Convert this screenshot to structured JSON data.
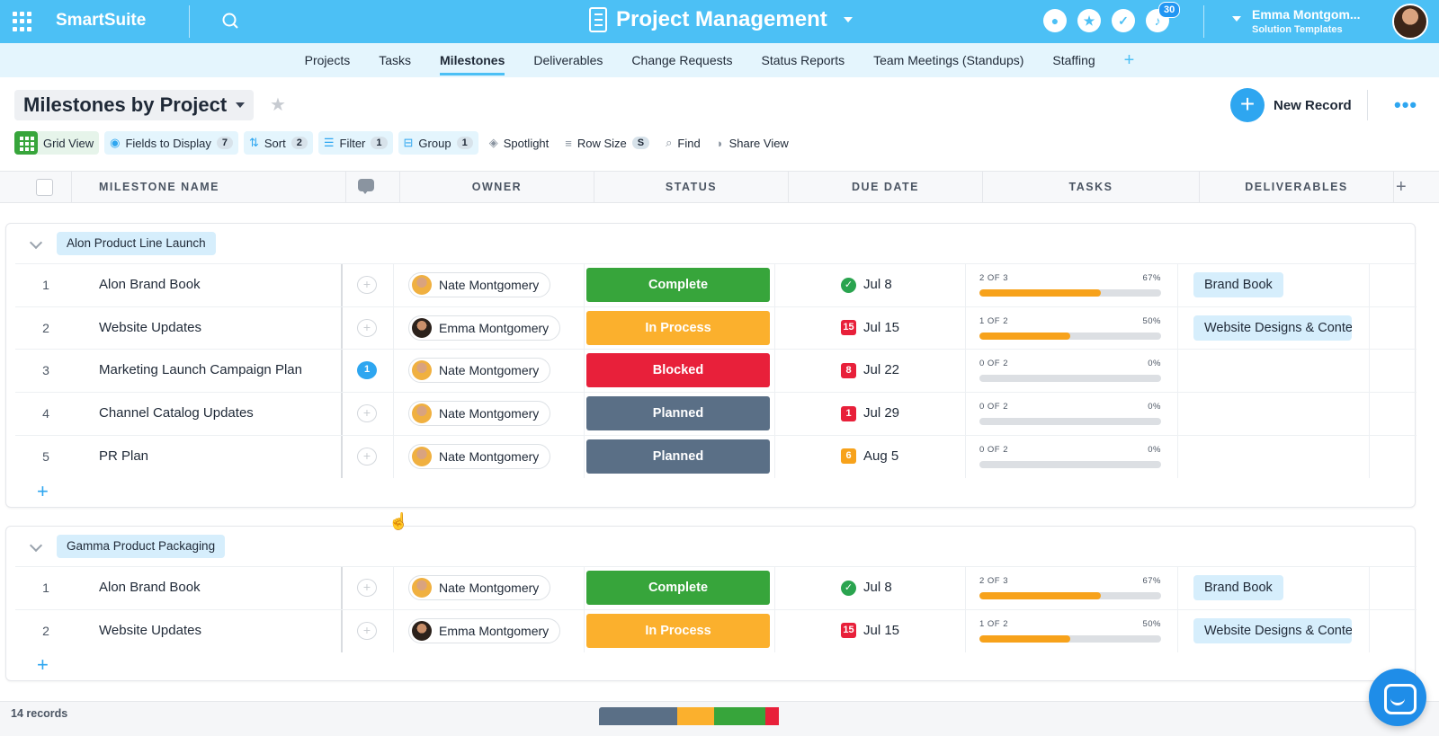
{
  "topbar": {
    "brand": "SmartSuite",
    "solution_title": "Project Management",
    "notification_count": "30",
    "user_name": "Emma Montgom...",
    "user_workspace": "Solution Templates"
  },
  "app_tabs": [
    {
      "label": "Projects",
      "active": false
    },
    {
      "label": "Tasks",
      "active": false
    },
    {
      "label": "Milestones",
      "active": true
    },
    {
      "label": "Deliverables",
      "active": false
    },
    {
      "label": "Change Requests",
      "active": false
    },
    {
      "label": "Status Reports",
      "active": false
    },
    {
      "label": "Team Meetings (Standups)",
      "active": false
    },
    {
      "label": "Staffing",
      "active": false
    }
  ],
  "view": {
    "title": "Milestones by Project",
    "new_record_label": "New Record"
  },
  "toolbar": {
    "grid_view": "Grid View",
    "fields": "Fields to Display",
    "fields_count": "7",
    "sort": "Sort",
    "sort_count": "2",
    "filter": "Filter",
    "filter_count": "1",
    "group": "Group",
    "group_count": "1",
    "spotlight": "Spotlight",
    "row_size": "Row Size",
    "row_size_value": "S",
    "find": "Find",
    "share_view": "Share View"
  },
  "columns": {
    "name": "MILESTONE NAME",
    "owner": "OWNER",
    "status": "STATUS",
    "due_date": "DUE DATE",
    "tasks": "TASKS",
    "deliverables": "DELIVERABLES"
  },
  "colors": {
    "accent": "#4cc0f5",
    "complete": "#37a53b",
    "in_process": "#fbb02d",
    "blocked": "#e8203a",
    "planned": "#5a6f86"
  },
  "groups": [
    {
      "label": "Alon Product Line Launch",
      "rows": [
        {
          "num": "1",
          "name": "Alon Brand Book",
          "comments": "",
          "owner": "Nate Montgomery",
          "owner_avatar": "nate",
          "status": "Complete",
          "status_key": "complete",
          "due_icon": "check",
          "due_badge": "",
          "due": "Jul 8",
          "tasks_label": "2 OF 3",
          "tasks_pct": "67%",
          "tasks_fraction": 0.67,
          "deliverable": "Brand Book"
        },
        {
          "num": "2",
          "name": "Website Updates",
          "comments": "",
          "owner": "Emma Montgomery",
          "owner_avatar": "emma",
          "status": "In Process",
          "status_key": "in_process",
          "due_icon": "badge",
          "due_badge": "15",
          "due": "Jul 15",
          "tasks_label": "1 OF 2",
          "tasks_pct": "50%",
          "tasks_fraction": 0.5,
          "deliverable": "Website Designs & Content"
        },
        {
          "num": "3",
          "name": "Marketing Launch Campaign Plan",
          "comments": "1",
          "owner": "Nate Montgomery",
          "owner_avatar": "nate",
          "status": "Blocked",
          "status_key": "blocked",
          "due_icon": "badge",
          "due_badge": "8",
          "due": "Jul 22",
          "tasks_label": "0 OF 2",
          "tasks_pct": "0%",
          "tasks_fraction": 0,
          "deliverable": ""
        },
        {
          "num": "4",
          "name": "Channel Catalog Updates",
          "comments": "",
          "owner": "Nate Montgomery",
          "owner_avatar": "nate",
          "status": "Planned",
          "status_key": "planned",
          "due_icon": "badge",
          "due_badge": "1",
          "due": "Jul 29",
          "tasks_label": "0 OF 2",
          "tasks_pct": "0%",
          "tasks_fraction": 0,
          "deliverable": ""
        },
        {
          "num": "5",
          "name": "PR Plan",
          "comments": "",
          "owner": "Nate Montgomery",
          "owner_avatar": "nate",
          "status": "Planned",
          "status_key": "planned",
          "due_icon": "badge",
          "due_badge": "6",
          "due": "Aug 5",
          "tasks_label": "0 OF 2",
          "tasks_pct": "0%",
          "tasks_fraction": 0,
          "deliverable": ""
        }
      ]
    },
    {
      "label": "Gamma Product Packaging",
      "rows": [
        {
          "num": "1",
          "name": "Alon Brand Book",
          "comments": "",
          "owner": "Nate Montgomery",
          "owner_avatar": "nate",
          "status": "Complete",
          "status_key": "complete",
          "due_icon": "check",
          "due_badge": "",
          "due": "Jul 8",
          "tasks_label": "2 OF 3",
          "tasks_pct": "67%",
          "tasks_fraction": 0.67,
          "deliverable": "Brand Book"
        },
        {
          "num": "2",
          "name": "Website Updates",
          "comments": "",
          "owner": "Emma Montgomery",
          "owner_avatar": "emma",
          "status": "In Process",
          "status_key": "in_process",
          "due_icon": "badge",
          "due_badge": "15",
          "due": "Jul 15",
          "tasks_label": "1 OF 2",
          "tasks_pct": "50%",
          "tasks_fraction": 0.5,
          "deliverable": "Website Designs & Content"
        }
      ]
    }
  ],
  "badge_colors": {
    "15": "#e8203a",
    "8": "#e8203a",
    "1": "#e8203a",
    "6": "#f7a21b"
  },
  "footer": {
    "records": "14 records",
    "status_summary": [
      {
        "status": "planned",
        "fraction": 0.42
      },
      {
        "status": "in_process",
        "fraction": 0.2
      },
      {
        "status": "complete",
        "fraction": 0.28
      },
      {
        "status": "blocked",
        "fraction": 0.07
      }
    ]
  }
}
